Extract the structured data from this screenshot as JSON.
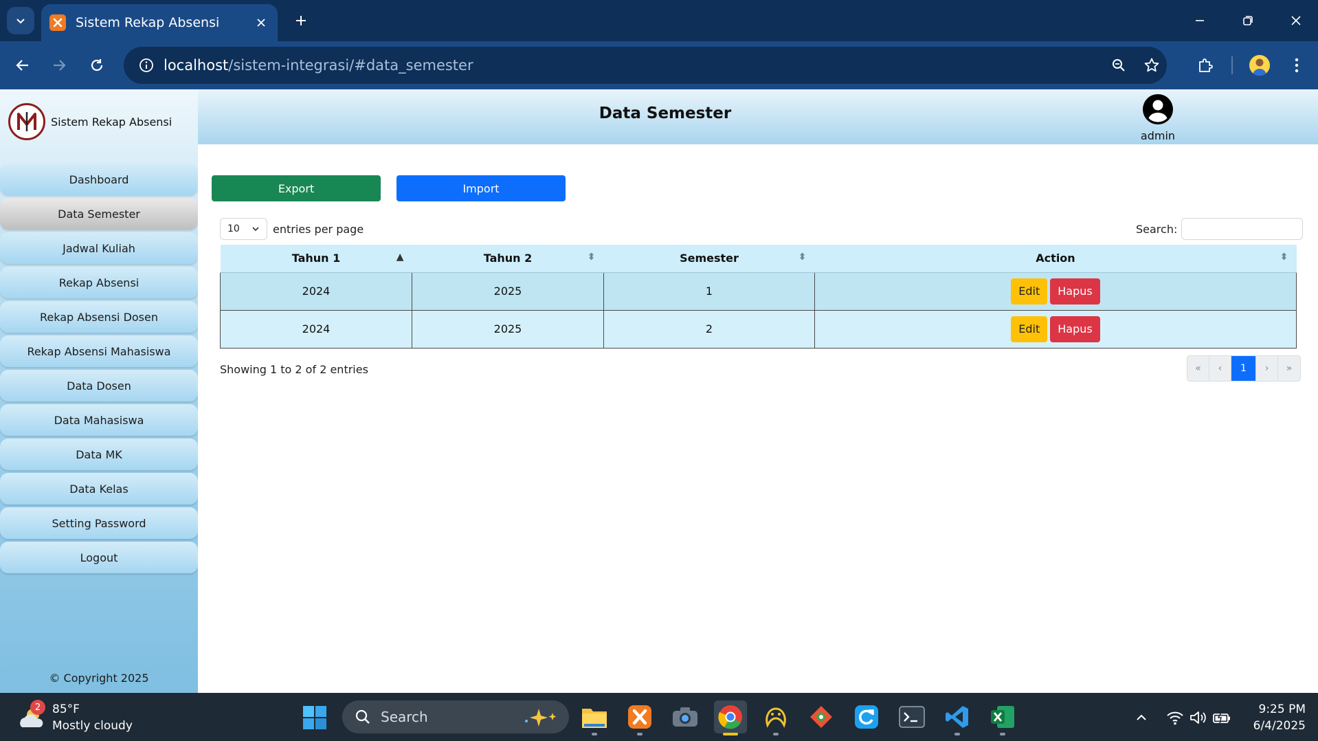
{
  "browser": {
    "tab_title": "Sistem Rekap Absensi",
    "url_host": "localhost",
    "url_path": "/sistem-integrasi/#data_semester"
  },
  "sidebar": {
    "brand": "Sistem Rekap Absensi",
    "items": [
      {
        "label": "Dashboard",
        "active": false
      },
      {
        "label": "Data Semester",
        "active": true
      },
      {
        "label": "Jadwal Kuliah",
        "active": false
      },
      {
        "label": "Rekap Absensi",
        "active": false
      },
      {
        "label": "Rekap Absensi Dosen",
        "active": false
      },
      {
        "label": "Rekap Absensi Mahasiswa",
        "active": false
      },
      {
        "label": "Data Dosen",
        "active": false
      },
      {
        "label": "Data Mahasiswa",
        "active": false
      },
      {
        "label": "Data MK",
        "active": false
      },
      {
        "label": "Data Kelas",
        "active": false
      },
      {
        "label": "Setting Password",
        "active": false
      },
      {
        "label": "Logout",
        "active": false
      }
    ],
    "copyright": "© Copyright 2025"
  },
  "header": {
    "title": "Data Semester",
    "user": "admin"
  },
  "main": {
    "export_label": "Export",
    "import_label": "Import",
    "entries_value": "10",
    "entries_label": "entries per page",
    "search_label": "Search:",
    "search_value": "",
    "columns": [
      "Tahun 1",
      "Tahun 2",
      "Semester",
      "Action"
    ],
    "rows": [
      {
        "tahun1": "2024",
        "tahun2": "2025",
        "semester": "1"
      },
      {
        "tahun1": "2024",
        "tahun2": "2025",
        "semester": "2"
      }
    ],
    "edit_label": "Edit",
    "delete_label": "Hapus",
    "showing": "Showing 1 to 2 of 2 entries",
    "pagination": {
      "first": "«",
      "prev": "‹",
      "current": "1",
      "next": "›",
      "last": "»"
    }
  },
  "taskbar": {
    "weather_badge": "2",
    "temperature": "85°F",
    "condition": "Mostly cloudy",
    "search_label": "Search",
    "time": "9:25 PM",
    "date": "6/4/2025"
  },
  "colors": {
    "export": "#198754",
    "import": "#0d6efd",
    "edit": "#ffc107",
    "delete": "#dc3545",
    "pager_active": "#0d6efd"
  }
}
